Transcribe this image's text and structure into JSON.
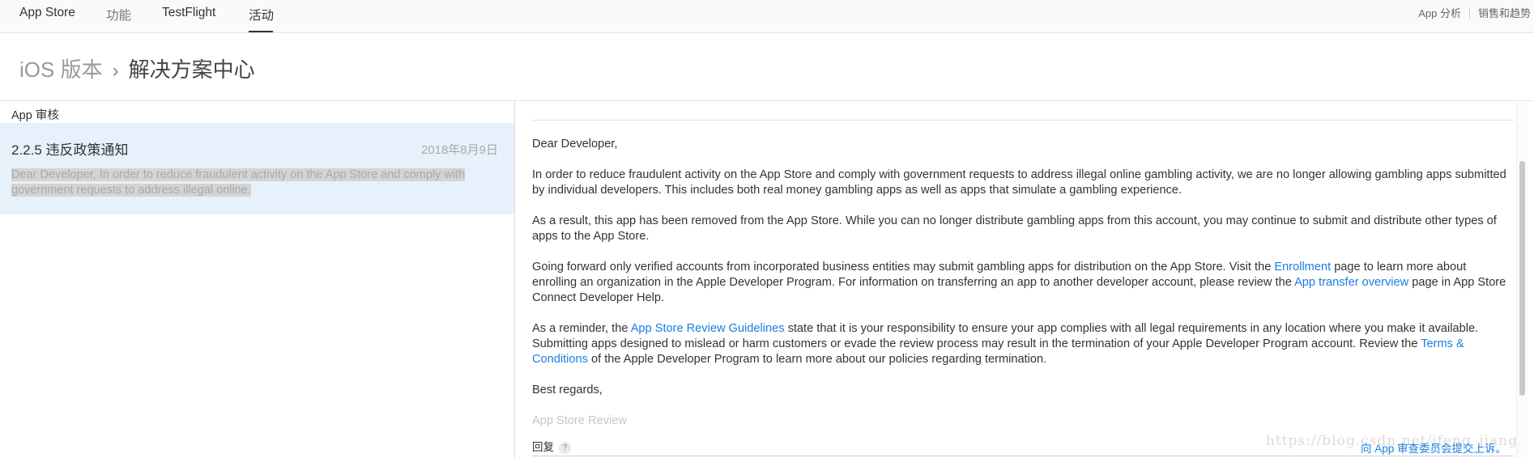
{
  "topnav": {
    "tabs": [
      {
        "label": "App Store"
      },
      {
        "label": "功能"
      },
      {
        "label": "TestFlight"
      },
      {
        "label": "活动"
      }
    ],
    "right_links": [
      "App 分析",
      "销售和趋势"
    ]
  },
  "breadcrumb": {
    "parent": "iOS 版本",
    "separator": "›",
    "current": "解决方案中心"
  },
  "left": {
    "section_label": "App 审核",
    "message": {
      "title": "2.2.5 违反政策通知",
      "date": "2018年8月9日",
      "preview": "Dear Developer, In order to reduce fraudulent activity on the App Store and comply with government requests to address illegal online."
    }
  },
  "letter": {
    "greeting": "Dear Developer,",
    "p1": "In order to reduce fraudulent activity on the App Store and comply with government requests to address illegal online gambling activity, we are no longer allowing gambling apps submitted by individual developers. This includes both real money gambling apps as well as apps that simulate a gambling experience.",
    "p2": "As a result, this app has been removed from the App Store. While you can no longer distribute gambling apps from this account, you may continue to submit and distribute other types of apps to the App Store.",
    "p3_a": "Going forward only verified accounts from incorporated business entities may submit gambling apps for distribution on the App Store. Visit the ",
    "p3_link1": "Enrollment",
    "p3_b": " page to learn more about enrolling an organization in the Apple Developer Program. For information on transferring an app to another developer account, please review the ",
    "p3_link2": "App transfer overview",
    "p3_c": " page in App Store Connect Developer Help.",
    "p4_a": "As a reminder, the ",
    "p4_link1": "App Store Review Guidelines",
    "p4_b": " state that it is your responsibility to ensure your app complies with all legal requirements in any location where you make it available. Submitting apps designed to mislead or harm customers or evade the review process may result in the termination of your Apple Developer Program account. Review the ",
    "p4_link2": "Terms & Conditions",
    "p4_c": " of the Apple Developer Program to learn more about our policies regarding termination.",
    "closing": "Best regards,",
    "signature": "App Store Review"
  },
  "reply": {
    "label": "回复",
    "help_glyph": "?",
    "submit_link": "向 App 审查委员会提交上诉。"
  },
  "watermark": "https://blog.csdn.net/ifeng_jiang"
}
